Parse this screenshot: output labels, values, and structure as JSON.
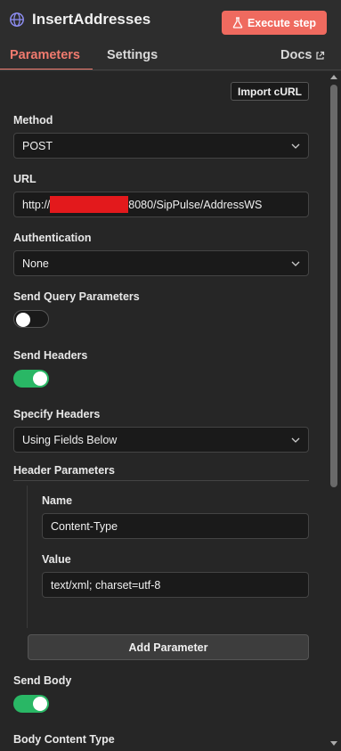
{
  "header": {
    "node_title": "InsertAddresses",
    "node_icon": "globe-icon",
    "execute_label": "Execute step",
    "execute_icon": "flask-icon",
    "accent": "#ef6a5f"
  },
  "tabs": [
    {
      "label": "Parameters",
      "active": true
    },
    {
      "label": "Settings",
      "active": false
    },
    {
      "label": "Docs",
      "active": false,
      "icon": "external-link-icon"
    }
  ],
  "form": {
    "import_curl_label": "Import cURL",
    "method": {
      "label": "Method",
      "value": "POST"
    },
    "url": {
      "label": "URL",
      "prefix": "http://",
      "suffix": "8080/SipPulse/AddressWS",
      "redacted": true
    },
    "authentication": {
      "label": "Authentication",
      "value": "None"
    },
    "send_query_parameters": {
      "label": "Send Query Parameters",
      "enabled": false
    },
    "send_headers": {
      "label": "Send Headers",
      "enabled": true
    },
    "specify_headers": {
      "label": "Specify Headers",
      "value": "Using Fields Below"
    },
    "header_parameters": {
      "label": "Header Parameters",
      "items": [
        {
          "name_label": "Name",
          "name_value": "Content-Type",
          "value_label": "Value",
          "value_value": "text/xml; charset=utf-8"
        }
      ],
      "add_label": "Add Parameter"
    },
    "send_body": {
      "label": "Send Body",
      "enabled": true
    },
    "body_content_type": {
      "label": "Body Content Type"
    }
  },
  "colors": {
    "toggle_on": "#29b765",
    "redaction": "#e3191c"
  }
}
